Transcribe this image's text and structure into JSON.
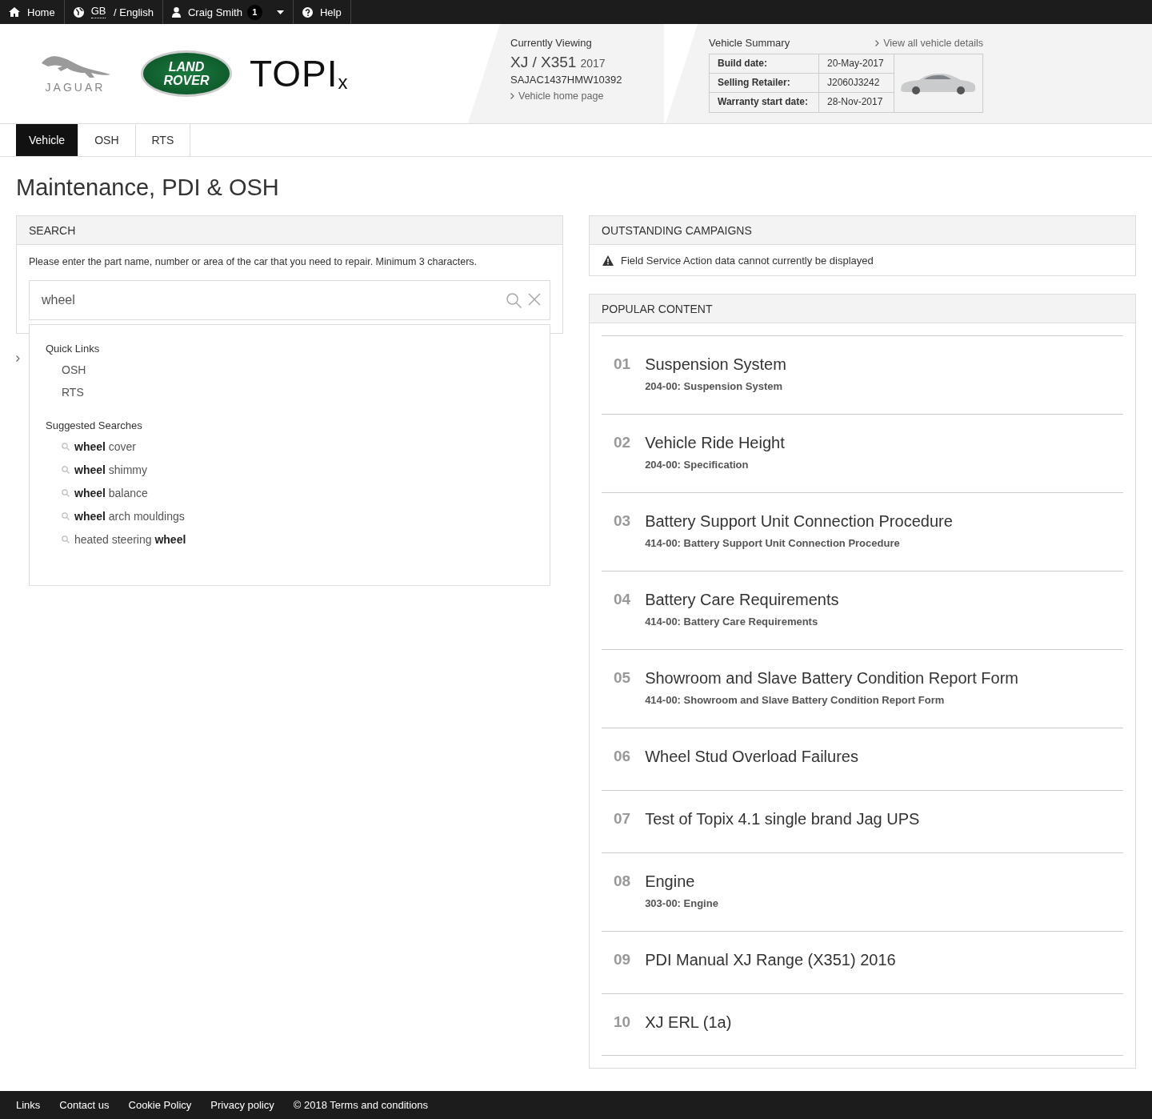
{
  "topbar": {
    "items": [
      {
        "kind": "home",
        "label": "Home"
      },
      {
        "kind": "language",
        "label": "GB",
        "suffix": " / English"
      },
      {
        "kind": "user",
        "label": "Craig Smith",
        "badge": "1"
      },
      {
        "kind": "help",
        "label": "Help"
      }
    ]
  },
  "logos": {
    "jaguar": "JAGUAR",
    "landrover_top": "LAND",
    "landrover_bottom": "ROVER",
    "topix": "TOPI",
    "topix_small": "x"
  },
  "current": {
    "heading": "Currently Viewing",
    "model": "XJ / X351",
    "year": "2017",
    "vin": "SAJAC1437HMW10392",
    "link": "Vehicle home page"
  },
  "summary": {
    "heading": "Vehicle Summary",
    "link": "View all vehicle details",
    "rows": [
      {
        "label": "Build date:",
        "value": "20-May-2017"
      },
      {
        "label": "Selling Retailer:",
        "value": "J2060J3242"
      },
      {
        "label": "Warranty start date:",
        "value": "28-Nov-2017"
      }
    ]
  },
  "tabs": [
    {
      "label": "Vehicle",
      "selected": true
    },
    {
      "label": "OSH",
      "selected": false
    },
    {
      "label": "RTS",
      "selected": false
    }
  ],
  "page_title": "Maintenance, PDI & OSH",
  "search": {
    "heading": "SEARCH",
    "hint": "Please enter the part name, number or area of the car that you need to repair. Minimum 3 characters.",
    "value": "wheel",
    "dropdown": {
      "quick_heading": "Quick Links",
      "quick_links": [
        "OSH",
        "RTS"
      ],
      "suggest_heading": "Suggested Searches",
      "suggestions": [
        "**wheel** cover",
        "**wheel** shimmy",
        "**wheel** balance",
        "**wheel** arch mouldings",
        "heated steering **wheel**"
      ]
    }
  },
  "campaigns": {
    "heading": "OUTSTANDING CAMPAIGNS",
    "message": "Field Service Action data cannot currently be displayed"
  },
  "popular": {
    "heading": "POPULAR CONTENT",
    "items": [
      {
        "number": "01",
        "title": "Suspension System",
        "subtitle": "204-00: Suspension System"
      },
      {
        "number": "02",
        "title": "Vehicle Ride Height",
        "subtitle": "204-00: Specification"
      },
      {
        "number": "03",
        "title": "Battery Support Unit Connection Procedure",
        "subtitle": "414-00: Battery Support Unit Connection Procedure"
      },
      {
        "number": "04",
        "title": "Battery Care Requirements",
        "subtitle": "414-00: Battery Care Requirements"
      },
      {
        "number": "05",
        "title": "Showroom and Slave Battery Condition Report Form",
        "subtitle": "414-00: Showroom and Slave Battery Condition Report Form"
      },
      {
        "number": "06",
        "title": "Wheel Stud Overload Failures"
      },
      {
        "number": "07",
        "title": "Test of Topix 4.1 single brand Jag UPS"
      },
      {
        "number": "08",
        "title": "Engine",
        "subtitle": "303-00: Engine"
      },
      {
        "number": "09",
        "title": "PDI Manual XJ Range (X351) 2016"
      },
      {
        "number": "10",
        "title": "XJ ERL (1a)"
      }
    ]
  },
  "footer": {
    "links": [
      "Links",
      "Contact us",
      "Cookie Policy",
      "Privacy policy",
      "© 2018 Terms and conditions"
    ]
  }
}
